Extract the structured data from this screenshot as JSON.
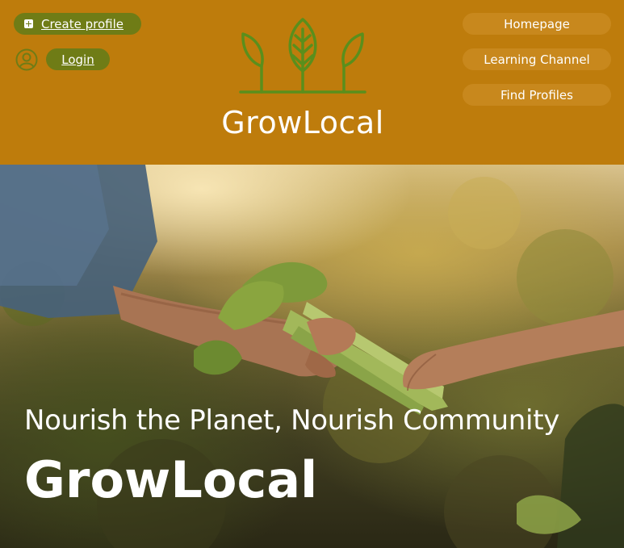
{
  "header": {
    "create_profile_label": "Create profile",
    "login_label": "Login",
    "brand_name": "GrowLocal",
    "nav": [
      {
        "label": "Homepage"
      },
      {
        "label": "Learning Channel"
      },
      {
        "label": "Find Profiles"
      }
    ]
  },
  "hero": {
    "tagline": "Nourish the Planet, Nourish Community",
    "title": "GrowLocal"
  },
  "icons": {
    "create_profile": "plus-icon",
    "login": "user-icon",
    "logo": "sprout-icon"
  },
  "colors": {
    "header_bg": "#be7c0c",
    "left_button_bg": "#6f7c16",
    "nav_button_bg": "#c8881d",
    "logo_green": "#5a8f1c",
    "text": "#ffffff"
  }
}
